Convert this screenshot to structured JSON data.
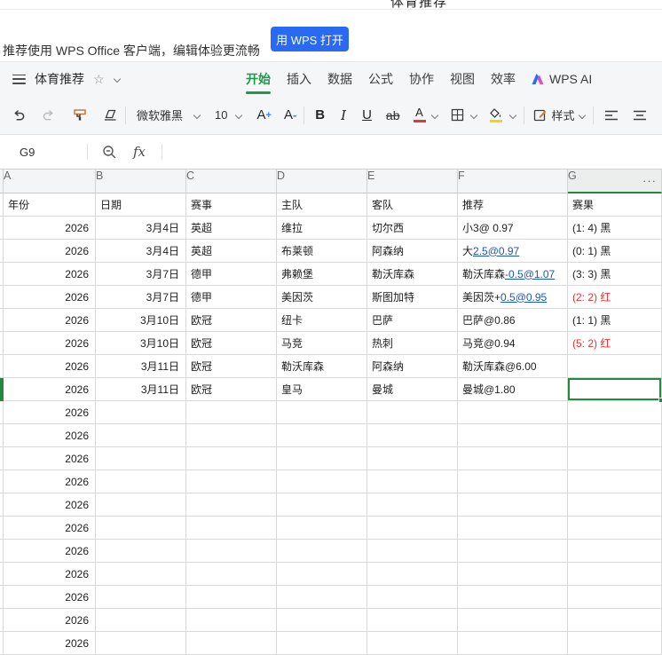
{
  "page": {
    "top_title": "体育推荐"
  },
  "banner": {
    "message": "推荐使用 WPS Office 客户端，编辑体验更流畅",
    "open_button": "用 WPS 打开"
  },
  "menubar": {
    "doc_title": "体育推荐",
    "tabs": [
      {
        "id": "start",
        "label": "开始",
        "active": true
      },
      {
        "id": "insert",
        "label": "插入",
        "active": false
      },
      {
        "id": "data",
        "label": "数据",
        "active": false
      },
      {
        "id": "formula",
        "label": "公式",
        "active": false
      },
      {
        "id": "collaborate",
        "label": "协作",
        "active": false
      },
      {
        "id": "view",
        "label": "视图",
        "active": false
      },
      {
        "id": "efficiency",
        "label": "效率",
        "active": false
      },
      {
        "id": "wps-ai",
        "label": "WPS AI",
        "active": false,
        "logo": true
      }
    ]
  },
  "toolbar": {
    "font_name": "微软雅黑",
    "font_size": "10",
    "bold_label": "B",
    "italic_label": "I",
    "underline_label": "U",
    "strikethrough_label": "ab",
    "font_color_glyph": "A",
    "increase_font_glyph": "A",
    "decrease_font_glyph": "A",
    "increase_sign": "+",
    "decrease_sign": "-",
    "style_label": "样式"
  },
  "formula_bar": {
    "cell_ref": "G9",
    "fx_label": "fx"
  },
  "icons": {
    "star": "☆",
    "more_columns": "···"
  },
  "colors": {
    "accent_green": "#218a3e",
    "tab_green": "#1c9a4c",
    "button_blue": "#2a6af2",
    "link_blue": "#1a56c4",
    "result_red": "#ef2d2d",
    "font_color_red": "#e23a30",
    "fill_yellow": "#f5d40e"
  },
  "sheet": {
    "column_letters": [
      "A",
      "B",
      "C",
      "D",
      "E",
      "F",
      "G"
    ],
    "headers": [
      "年份",
      "日期",
      "赛事",
      "主队",
      "客队",
      "推荐",
      "赛果"
    ],
    "selected_cell": "G9",
    "rows": [
      {
        "year": "2026",
        "date": "3月4日",
        "league": "英超",
        "home": "维拉",
        "away": "切尔西",
        "tip_plain": "小3@ 0.97",
        "tip_link": "",
        "result": "(1: 4) 黑",
        "result_color": "black"
      },
      {
        "year": "2026",
        "date": "3月4日",
        "league": "英超",
        "home": "布莱顿",
        "away": "阿森纳",
        "tip_plain": "大",
        "tip_link": "2.5@0.97",
        "result": "(0: 1) 黑",
        "result_color": "black"
      },
      {
        "year": "2026",
        "date": "3月7日",
        "league": "德甲",
        "home": "弗赖堡",
        "away": "勒沃库森",
        "tip_plain": "勒沃库森",
        "tip_link": "-0.5@1.07",
        "result": "(3: 3) 黑",
        "result_color": "black"
      },
      {
        "year": "2026",
        "date": "3月7日",
        "league": "德甲",
        "home": "美因茨",
        "away": "斯图加特",
        "tip_plain": "美因茨+",
        "tip_link": "0.5@0.95",
        "result": "(2: 2) 红",
        "result_color": "red"
      },
      {
        "year": "2026",
        "date": "3月10日",
        "league": "欧冠",
        "home": "纽卡",
        "away": "巴萨",
        "tip_plain": "巴萨@0.86",
        "tip_link": "",
        "result": "(1: 1) 黑",
        "result_color": "black"
      },
      {
        "year": "2026",
        "date": "3月10日",
        "league": "欧冠",
        "home": "马竞",
        "away": "热刺",
        "tip_plain": "马竞@0.94",
        "tip_link": "",
        "result": "(5: 2) 红",
        "result_color": "red"
      },
      {
        "year": "2026",
        "date": "3月11日",
        "league": "欧冠",
        "home": "勒沃库森",
        "away": "阿森纳",
        "tip_plain": "勒沃库森@6.00",
        "tip_link": "",
        "result": "",
        "result_color": "black"
      },
      {
        "year": "2026",
        "date": "3月11日",
        "league": "欧冠",
        "home": "皇马",
        "away": "曼城",
        "tip_plain": "曼城@1.80",
        "tip_link": "",
        "result": "",
        "result_color": "black",
        "selected": true
      }
    ],
    "trailing_year_rows": {
      "count": 11,
      "year": "2026"
    }
  }
}
